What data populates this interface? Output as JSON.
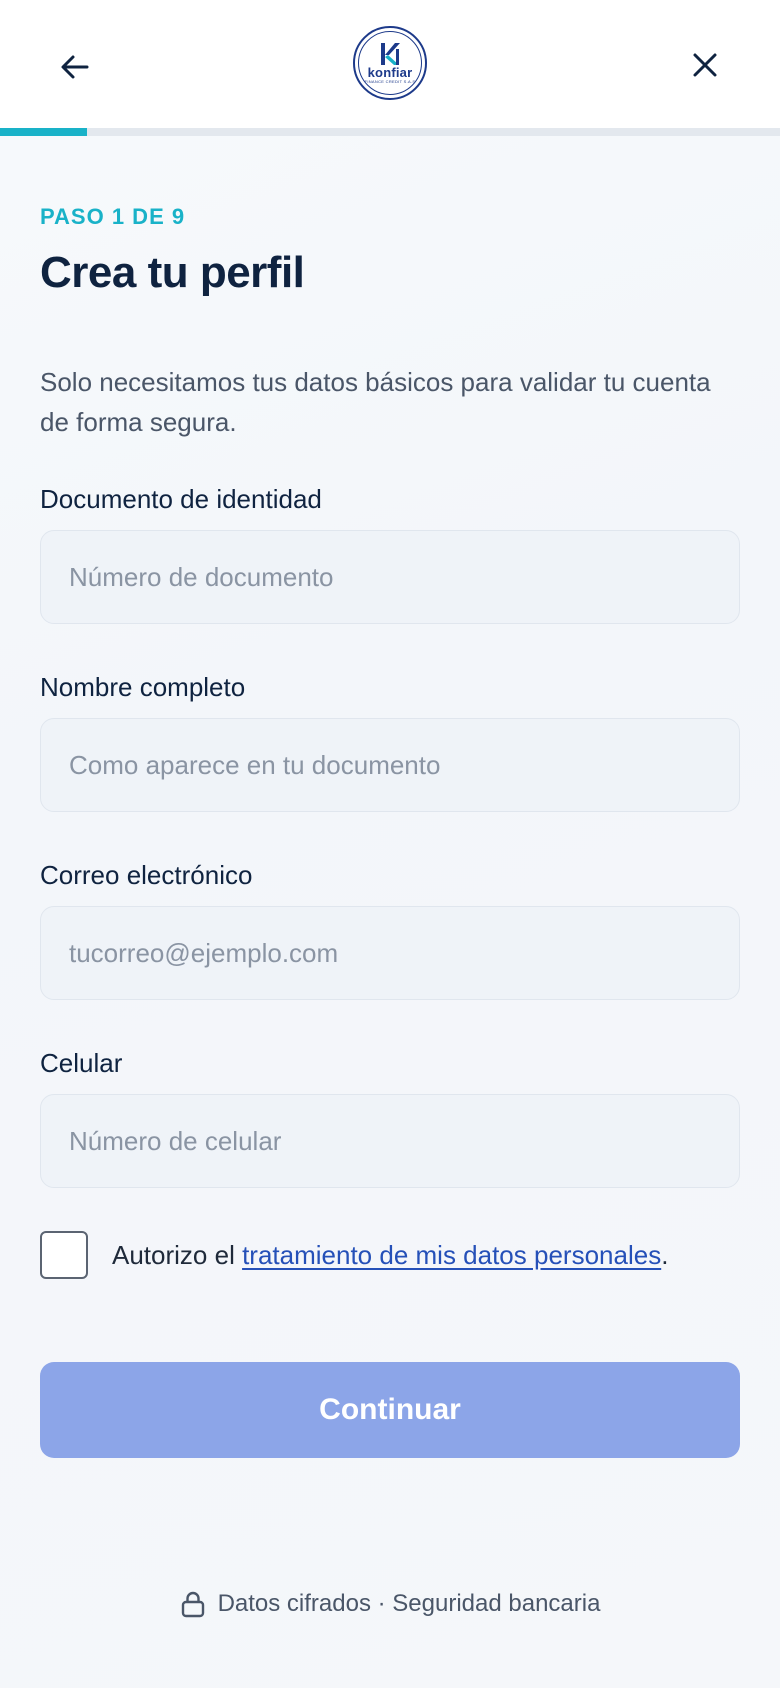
{
  "header": {
    "back_icon": "arrow-left-icon",
    "close_icon": "close-icon",
    "logo": {
      "word": "konfiar",
      "tagline": "FINANCE CREDIT S.A.S"
    },
    "progress": 0.111
  },
  "step": {
    "label": "PASO 1 DE 9"
  },
  "title": "Crea tu perfil",
  "subtitle": "Solo necesitamos tus datos básicos para validar tu cuenta de forma segura.",
  "fields": [
    {
      "label": "Documento de identidad",
      "placeholder": "Número de documento",
      "value": ""
    },
    {
      "label": "Nombre completo",
      "placeholder": "Como aparece en tu documento",
      "value": ""
    },
    {
      "label": "Correo electrónico",
      "placeholder": "tucorreo@ejemplo.com",
      "value": ""
    },
    {
      "label": "Celular",
      "placeholder": "Número de celular",
      "value": ""
    }
  ],
  "consent": {
    "prefix": "Autorizo el ",
    "link": "tratamiento de mis datos personales",
    "suffix": ".",
    "checked": false
  },
  "continue_label": "Continuar",
  "footer": {
    "icon": "lock-icon",
    "text": "Datos cifrados · Seguridad bancaria"
  },
  "colors": {
    "accent": "#19b2c8",
    "brand": "#1d3a8a",
    "button_disabled": "#8ca5e8",
    "link": "#2550b8",
    "title": "#0f2340"
  }
}
